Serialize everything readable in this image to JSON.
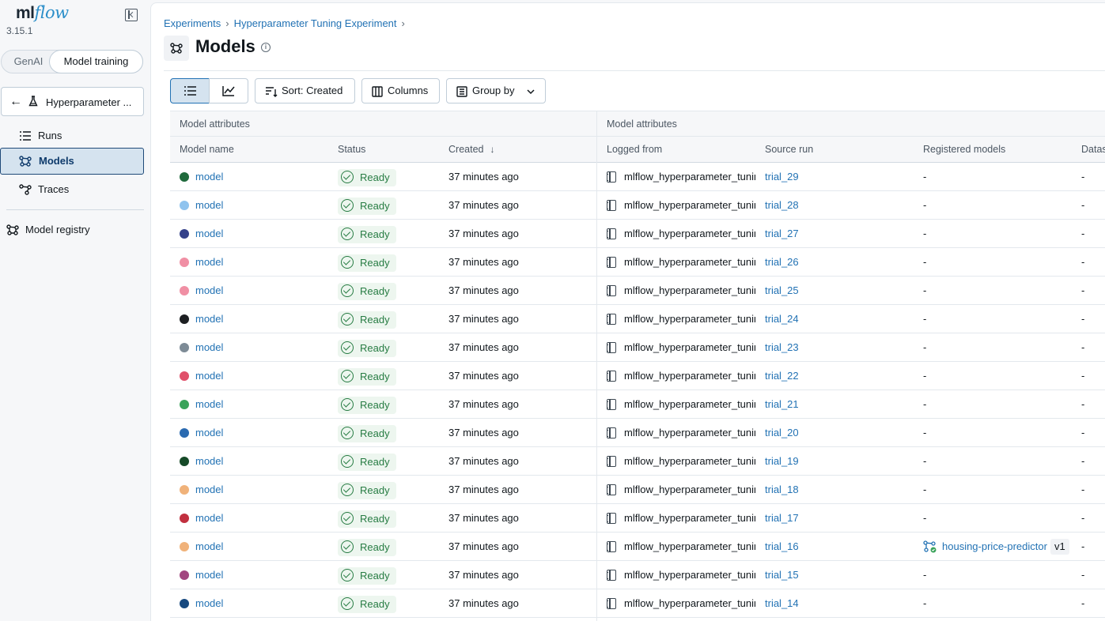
{
  "app": {
    "logo_ml": "ml",
    "logo_flow": "flow",
    "version": "3.15.1"
  },
  "sidebar": {
    "modes": [
      "GenAI",
      "Model training"
    ],
    "active_mode": "Model training",
    "experiment_label": "Hyperparameter ...",
    "items": [
      {
        "label": "Runs",
        "icon": "list-icon"
      },
      {
        "label": "Models",
        "icon": "models-icon",
        "active": true
      },
      {
        "label": "Traces",
        "icon": "traces-icon"
      }
    ],
    "registry_label": "Model registry"
  },
  "breadcrumb": {
    "items": [
      "Experiments",
      "Hyperparameter Tuning Experiment"
    ],
    "separator": "›"
  },
  "page": {
    "title": "Models",
    "info_icon": "i"
  },
  "toolbar": {
    "sort_label": "Sort: Created",
    "columns_label": "Columns",
    "group_label": "Group by"
  },
  "table": {
    "group_headers": [
      "Model attributes",
      "Model attributes"
    ],
    "columns": [
      "Model name",
      "Status",
      "Created",
      "Logged from",
      "Source run",
      "Registered models",
      "Datas"
    ],
    "sort_indicator": "↓",
    "rows": [
      {
        "name": "model",
        "color": "#1f6a3c",
        "status": "Ready",
        "created": "37 minutes ago",
        "logged_from": "mlflow_hyperparameter_tuning",
        "source_run": "trial_29",
        "registered": "-",
        "dataset": "-"
      },
      {
        "name": "model",
        "color": "#8fc3ee",
        "status": "Ready",
        "created": "37 minutes ago",
        "logged_from": "mlflow_hyperparameter_tuning",
        "source_run": "trial_28",
        "registered": "-",
        "dataset": "-"
      },
      {
        "name": "model",
        "color": "#35418a",
        "status": "Ready",
        "created": "37 minutes ago",
        "logged_from": "mlflow_hyperparameter_tuning",
        "source_run": "trial_27",
        "registered": "-",
        "dataset": "-"
      },
      {
        "name": "model",
        "color": "#f08fa4",
        "status": "Ready",
        "created": "37 minutes ago",
        "logged_from": "mlflow_hyperparameter_tuning",
        "source_run": "trial_26",
        "registered": "-",
        "dataset": "-"
      },
      {
        "name": "model",
        "color": "#f08fa4",
        "status": "Ready",
        "created": "37 minutes ago",
        "logged_from": "mlflow_hyperparameter_tuning",
        "source_run": "trial_25",
        "registered": "-",
        "dataset": "-"
      },
      {
        "name": "model",
        "color": "#1d1f22",
        "status": "Ready",
        "created": "37 minutes ago",
        "logged_from": "mlflow_hyperparameter_tuning",
        "source_run": "trial_24",
        "registered": "-",
        "dataset": "-"
      },
      {
        "name": "model",
        "color": "#7d8b96",
        "status": "Ready",
        "created": "37 minutes ago",
        "logged_from": "mlflow_hyperparameter_tuning",
        "source_run": "trial_23",
        "registered": "-",
        "dataset": "-"
      },
      {
        "name": "model",
        "color": "#e0506a",
        "status": "Ready",
        "created": "37 minutes ago",
        "logged_from": "mlflow_hyperparameter_tuning",
        "source_run": "trial_22",
        "registered": "-",
        "dataset": "-"
      },
      {
        "name": "model",
        "color": "#3aa35a",
        "status": "Ready",
        "created": "37 minutes ago",
        "logged_from": "mlflow_hyperparameter_tuning",
        "source_run": "trial_21",
        "registered": "-",
        "dataset": "-"
      },
      {
        "name": "model",
        "color": "#2a6ab0",
        "status": "Ready",
        "created": "37 minutes ago",
        "logged_from": "mlflow_hyperparameter_tuning",
        "source_run": "trial_20",
        "registered": "-",
        "dataset": "-"
      },
      {
        "name": "model",
        "color": "#164a28",
        "status": "Ready",
        "created": "37 minutes ago",
        "logged_from": "mlflow_hyperparameter_tuning",
        "source_run": "trial_19",
        "registered": "-",
        "dataset": "-"
      },
      {
        "name": "model",
        "color": "#f0b27a",
        "status": "Ready",
        "created": "37 minutes ago",
        "logged_from": "mlflow_hyperparameter_tuning",
        "source_run": "trial_18",
        "registered": "-",
        "dataset": "-"
      },
      {
        "name": "model",
        "color": "#c1303f",
        "status": "Ready",
        "created": "37 minutes ago",
        "logged_from": "mlflow_hyperparameter_tuning",
        "source_run": "trial_17",
        "registered": "-",
        "dataset": "-"
      },
      {
        "name": "model",
        "color": "#f0b27a",
        "status": "Ready",
        "created": "37 minutes ago",
        "logged_from": "mlflow_hyperparameter_tuning",
        "source_run": "trial_16",
        "registered": "housing-price-predictor",
        "registered_version": "v1",
        "dataset": "-"
      },
      {
        "name": "model",
        "color": "#a2467f",
        "status": "Ready",
        "created": "37 minutes ago",
        "logged_from": "mlflow_hyperparameter_tuning",
        "source_run": "trial_15",
        "registered": "-",
        "dataset": "-"
      },
      {
        "name": "model",
        "color": "#17497f",
        "status": "Ready",
        "created": "37 minutes ago",
        "logged_from": "mlflow_hyperparameter_tuning",
        "source_run": "trial_14",
        "registered": "-",
        "dataset": "-"
      }
    ]
  }
}
